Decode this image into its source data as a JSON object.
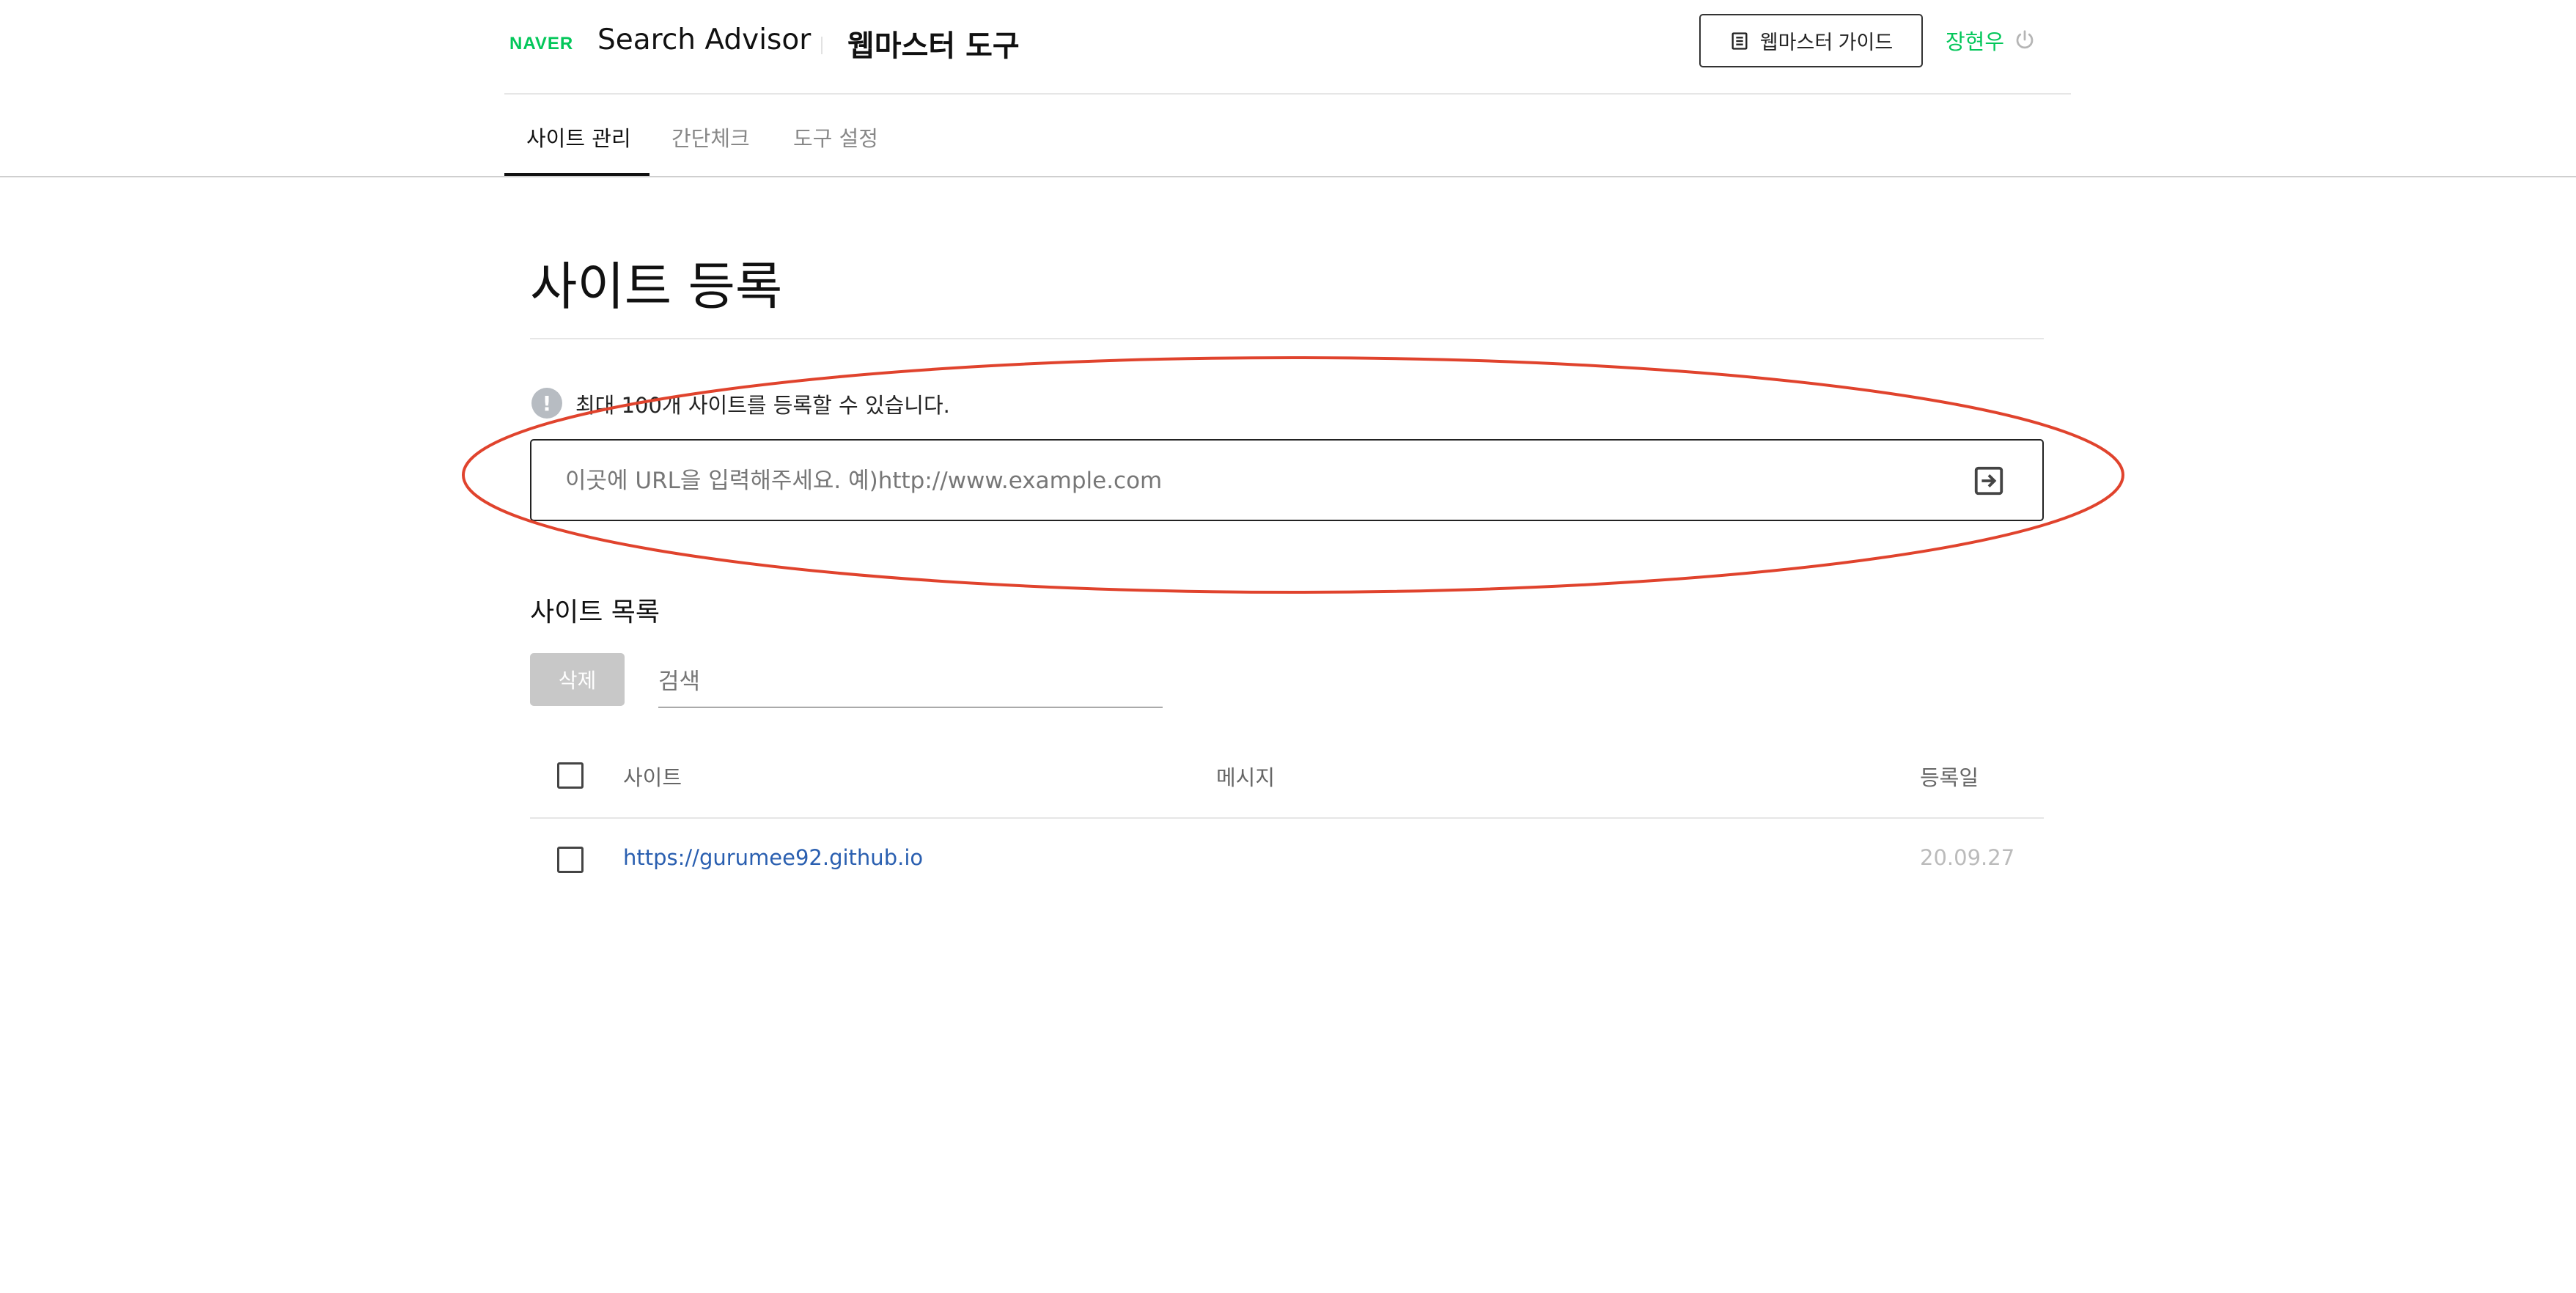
{
  "header": {
    "logo": "NAVER",
    "service": "Search Advisor",
    "tool": "웹마스터 도구",
    "guide_label": "웹마스터 가이드",
    "user": "장현우"
  },
  "nav": {
    "tabs": [
      {
        "label": "사이트 관리",
        "active": true
      },
      {
        "label": "간단체크",
        "active": false
      },
      {
        "label": "도구 설정",
        "active": false
      }
    ]
  },
  "main": {
    "title": "사이트 등록",
    "notice": "최대 100개 사이트를 등록할 수 있습니다.",
    "url_placeholder": "이곳에 URL을 입력해주세요. 예)http://www.example.com",
    "annotation_color": "#e0432d"
  },
  "site_list": {
    "title": "사이트 목록",
    "delete_label": "삭제",
    "search_placeholder": "검색",
    "columns": {
      "site": "사이트",
      "message": "메시지",
      "date": "등록일"
    },
    "rows": [
      {
        "site": "https://gurumee92.github.io",
        "message": "",
        "date": "20.09.27",
        "checked": false
      }
    ]
  },
  "colors": {
    "brand": "#03c75a",
    "link": "#2a5fb0"
  }
}
